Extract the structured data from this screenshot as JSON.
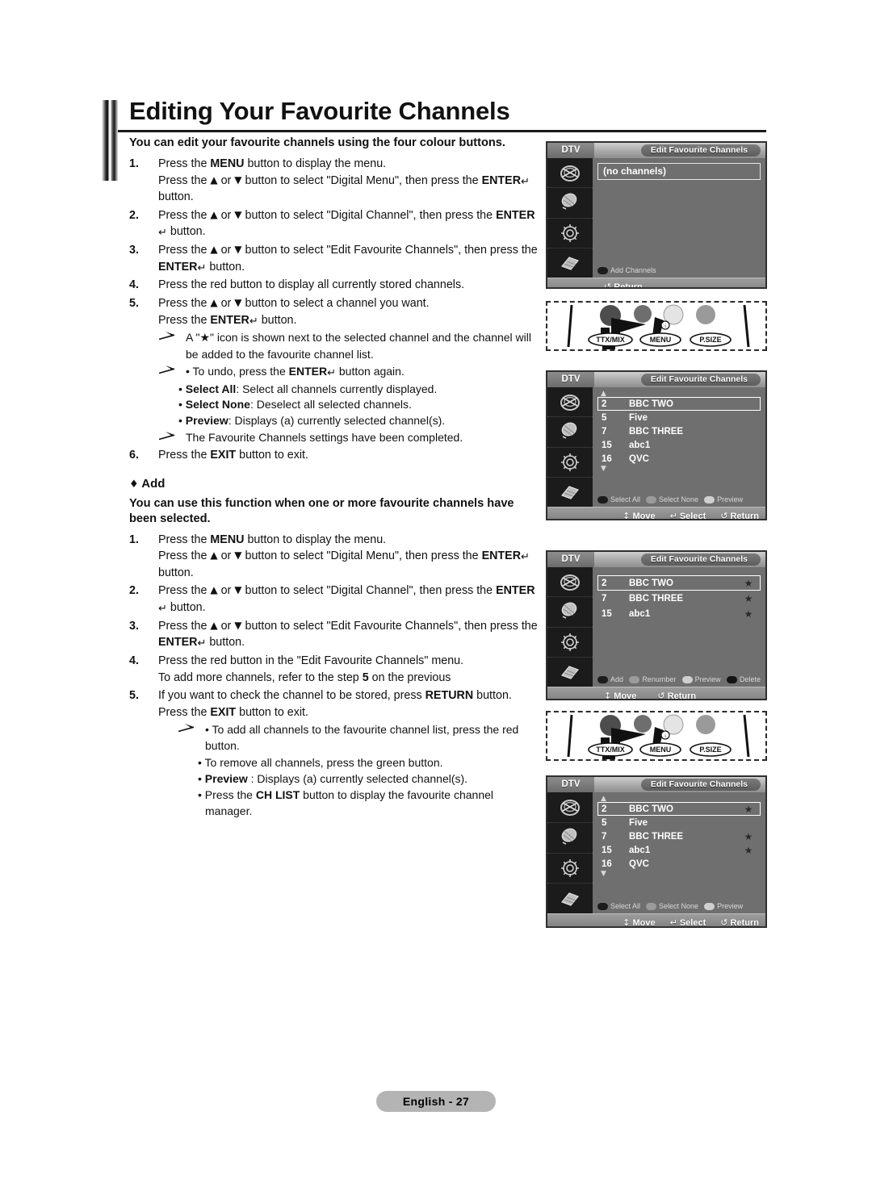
{
  "page": {
    "title": "Editing Your Favourite Channels",
    "footer_label": "English - 27"
  },
  "intro": {
    "text": "You can edit your favourite channels using the four colour buttons."
  },
  "section1": {
    "steps": [
      {
        "num": "1.",
        "lines": [
          "Press the MENU button to display the menu.",
          "Press the ▲ or ▼ button to select \"Digital Menu\", then press the ENTER↵ button."
        ]
      },
      {
        "num": "2.",
        "lines": [
          "Press the ▲ or ▼ button to select \"Digital Channel\", then press the ENTER↵ button."
        ]
      },
      {
        "num": "3.",
        "lines": [
          "Press the ▲ or ▼ button to select \"Edit Favourite Channels\", then press the ENTER↵ button."
        ]
      },
      {
        "num": "4.",
        "lines": [
          "Press the red button to display all currently stored channels."
        ]
      },
      {
        "num": "5.",
        "lines": [
          "Press the ▲ or ▼ button to select a channel you want.",
          "Press the ENTER↵ button."
        ]
      },
      {
        "num": "6.",
        "lines": [
          "Press the EXIT button to exit."
        ]
      }
    ],
    "note_star": "A \"★\" icon is shown next to the selected channel and the channel will be added to the favourite channel list.",
    "note_undo": "• To undo, press the ENTER↵ button again.",
    "bullets": [
      "• Select All: Select all channels currently displayed.",
      "• Select None: Deselect all selected channels.",
      "• Preview: Displays (a) currently selected channel(s)."
    ],
    "note_completed": "The Favourite Channels settings have been completed."
  },
  "section2": {
    "heading": "♦ Add",
    "intro": "You can use this function when one or more favourite channels have been selected.",
    "steps": [
      {
        "num": "1.",
        "lines": [
          "Press the MENU button to display the menu.",
          "Press the ▲ or ▼ button to select \"Digital Menu\", then press the ENTER↵ button."
        ]
      },
      {
        "num": "2.",
        "lines": [
          "Press the ▲ or ▼ button to select \"Digital Channel\", then press the ENTER↵ button."
        ]
      },
      {
        "num": "3.",
        "lines": [
          "Press the ▲ or ▼ button to select \"Edit Favourite Channels\", then press the ENTER↵ button."
        ]
      },
      {
        "num": "4.",
        "lines": [
          "Press the red button in the \"Edit Favourite Channels\" menu.",
          "To add more channels, refer to the step 5 on the previous"
        ]
      },
      {
        "num": "5.",
        "lines": [
          "If you want to check the channel to be stored, press RETURN button.",
          "Press the EXIT button to exit."
        ]
      }
    ],
    "bullets": [
      "• To add all channels to the favourite channel list, press the red button.",
      "• To remove all channels, press the green button.",
      "• Preview : Displays (a) currently selected channel(s).",
      "• Press the CH LIST button to display the favourite channel manager."
    ]
  },
  "tv_screens": [
    {
      "id": "screen-no-channels",
      "source_label": "DTV",
      "menu_title": "Edit Favourite Channels",
      "empty_text": "(no channels)",
      "colour_buttons": [
        {
          "colour": "red",
          "label": "Add Channels"
        }
      ],
      "footer_items": [
        {
          "glyph": "↺",
          "label": "Return"
        }
      ]
    },
    {
      "id": "screen-all-channels",
      "source_label": "DTV",
      "menu_title": "Edit Favourite Channels",
      "scroll_up": "▲",
      "scroll_down": "▼",
      "channels": [
        {
          "num": "2",
          "name": "BBC TWO",
          "selected": true,
          "star": ""
        },
        {
          "num": "5",
          "name": "Five",
          "selected": false,
          "star": ""
        },
        {
          "num": "7",
          "name": "BBC THREE",
          "selected": false,
          "star": ""
        },
        {
          "num": "15",
          "name": "abc1",
          "selected": false,
          "star": ""
        },
        {
          "num": "16",
          "name": "QVC",
          "selected": false,
          "star": ""
        }
      ],
      "colour_buttons": [
        {
          "colour": "red",
          "label": "Select All"
        },
        {
          "colour": "green",
          "label": "Select None"
        },
        {
          "colour": "yellow",
          "label": "Preview"
        }
      ],
      "footer_items": [
        {
          "glyph": "↕",
          "label": "Move"
        },
        {
          "glyph": "↵",
          "label": "Select"
        },
        {
          "glyph": "↺",
          "label": "Return"
        }
      ]
    },
    {
      "id": "screen-favourites",
      "source_label": "DTV",
      "menu_title": "Edit Favourite Channels",
      "channels": [
        {
          "num": "2",
          "name": "BBC TWO",
          "selected": true,
          "star": "★"
        },
        {
          "num": "7",
          "name": "BBC THREE",
          "selected": false,
          "star": "★"
        },
        {
          "num": "15",
          "name": "abc1",
          "selected": false,
          "star": "★"
        }
      ],
      "colour_buttons": [
        {
          "colour": "red",
          "label": "Add"
        },
        {
          "colour": "green",
          "label": "Renumber"
        },
        {
          "colour": "yellow",
          "label": "Preview"
        },
        {
          "colour": "blue",
          "label": "Delete"
        }
      ],
      "footer_items": [
        {
          "glyph": "↕",
          "label": "Move"
        },
        {
          "glyph": "↺",
          "label": "Return"
        }
      ]
    },
    {
      "id": "screen-all-channels-starred",
      "source_label": "DTV",
      "menu_title": "Edit Favourite Channels",
      "scroll_up": "▲",
      "scroll_down": "▼",
      "channels": [
        {
          "num": "2",
          "name": "BBC TWO",
          "selected": true,
          "star": "★"
        },
        {
          "num": "5",
          "name": "Five",
          "selected": false,
          "star": ""
        },
        {
          "num": "7",
          "name": "BBC THREE",
          "selected": false,
          "star": "★"
        },
        {
          "num": "15",
          "name": "abc1",
          "selected": false,
          "star": "★"
        },
        {
          "num": "16",
          "name": "QVC",
          "selected": false,
          "star": ""
        }
      ],
      "colour_buttons": [
        {
          "colour": "red",
          "label": "Select All"
        },
        {
          "colour": "green",
          "label": "Select None"
        },
        {
          "colour": "yellow",
          "label": "Preview"
        }
      ],
      "footer_items": [
        {
          "glyph": "↕",
          "label": "Move"
        },
        {
          "glyph": "↵",
          "label": "Select"
        },
        {
          "glyph": "↺",
          "label": "Return"
        }
      ]
    }
  ],
  "remotes": [
    {
      "id": "remote-top",
      "buttons": [
        "TTX/MIX",
        "MENU",
        "P.SIZE"
      ]
    },
    {
      "id": "remote-bottom",
      "buttons": [
        "TTX/MIX",
        "MENU",
        "P.SIZE"
      ]
    }
  ],
  "colors": {
    "screen_bg": "#6f6f6f",
    "screen_border": "#2f2f2f",
    "sidebar_bg": "#1b1b1b",
    "footer_pill": "#b4b4b4"
  }
}
